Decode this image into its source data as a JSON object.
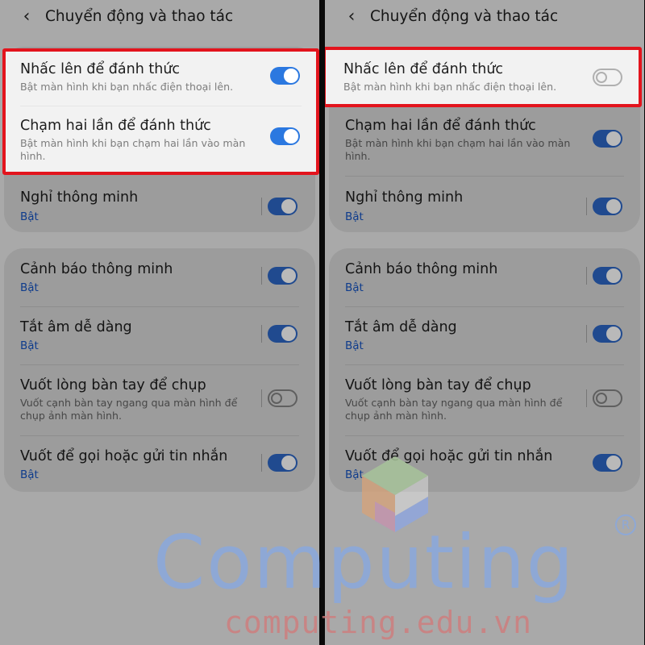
{
  "colors": {
    "accent": "#2b78e0",
    "highlight_border": "#e3141d",
    "status_blue": "#0f3c8c",
    "watermark_blue": "#8aa8dd",
    "watermark_red": "#d07b7b"
  },
  "header": {
    "back_icon": "chevron-left-icon",
    "back_glyph": "‹",
    "title": "Chuyển động và thao tác"
  },
  "left": {
    "items": [
      {
        "title": "Nhấc lên để đánh thức",
        "desc": "Bật màn hình khi bạn nhấc điện thoại lên.",
        "toggle": "on"
      },
      {
        "title": "Chạm hai lần để đánh thức",
        "desc": "Bật màn hình khi bạn chạm hai lần vào màn hình.",
        "toggle": "on"
      },
      {
        "title": "Nghỉ thông minh",
        "status": "Bật",
        "toggle": "on"
      },
      {
        "title": "Cảnh báo thông minh",
        "status": "Bật",
        "toggle": "on"
      },
      {
        "title": "Tắt âm dễ dàng",
        "status": "Bật",
        "toggle": "on"
      },
      {
        "title": "Vuốt lòng bàn tay để chụp",
        "desc": "Vuốt cạnh bàn tay ngang qua màn hình để chụp ảnh màn hình.",
        "toggle": "off"
      },
      {
        "title": "Vuốt để gọi hoặc gửi tin nhắn",
        "status": "Bật",
        "toggle": "on"
      }
    ]
  },
  "right": {
    "items": [
      {
        "title": "Nhấc lên để đánh thức",
        "desc": "Bật màn hình khi bạn nhấc điện thoại lên.",
        "toggle": "off"
      },
      {
        "title": "Chạm hai lần để đánh thức",
        "desc": "Bật màn hình khi bạn chạm hai lần vào màn hình.",
        "toggle": "on"
      },
      {
        "title": "Nghỉ thông minh",
        "status": "Bật",
        "toggle": "on"
      },
      {
        "title": "Cảnh báo thông minh",
        "status": "Bật",
        "toggle": "on"
      },
      {
        "title": "Tắt âm dễ dàng",
        "status": "Bật",
        "toggle": "on"
      },
      {
        "title": "Vuốt lòng bàn tay để chụp",
        "desc": "Vuốt cạnh bàn tay ngang qua màn hình để chụp ảnh màn hình.",
        "toggle": "off"
      },
      {
        "title": "Vuốt để gọi hoặc gửi tin nhắn",
        "status": "Bật",
        "toggle": "on"
      }
    ]
  },
  "watermark": {
    "name": "Computing",
    "reg": "R",
    "url": "computing.edu.vn"
  }
}
